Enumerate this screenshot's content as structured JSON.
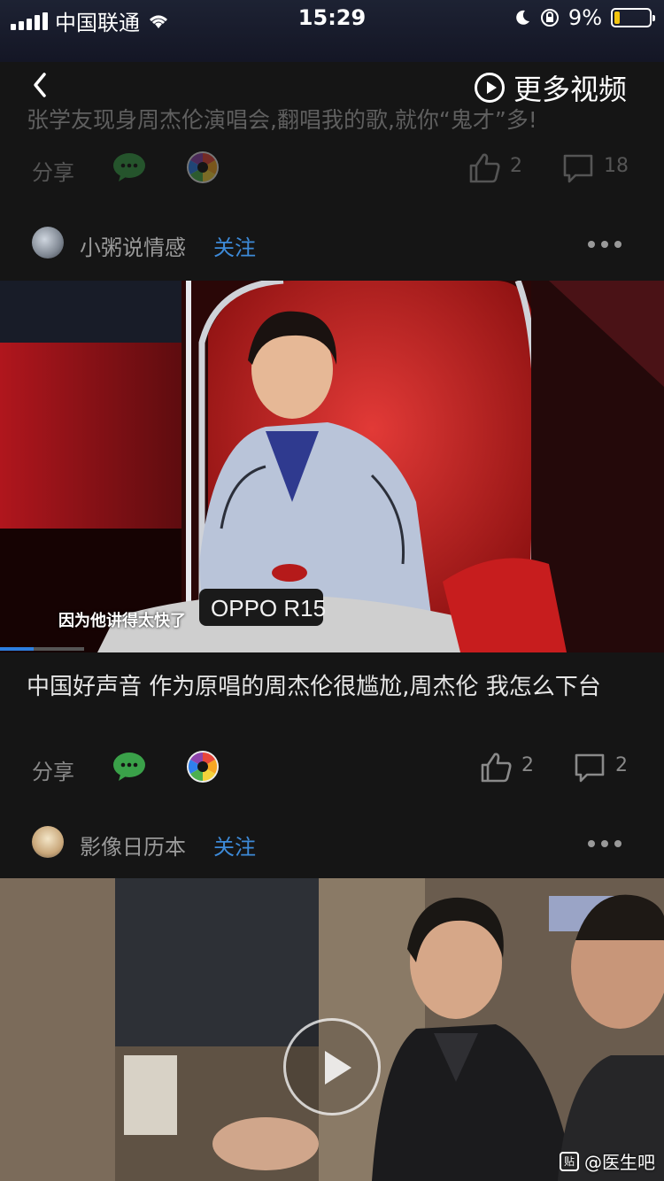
{
  "status_bar": {
    "carrier": "中国联通",
    "time": "15:29",
    "battery": "9%"
  },
  "nav": {
    "more_videos": "更多视频"
  },
  "posts": [
    {
      "title": "张学友现身周杰伦演唱会,翻唱我的歌,就你“鬼才”多!",
      "share_label": "分享",
      "likes": "2",
      "comments": "18"
    },
    {
      "author": "小粥说情感",
      "follow": "关注",
      "video_subtitle": "因为他讲得太快了",
      "video_brand": "OPPO R15",
      "progress": 0.05,
      "title": "中国好声音 作为原唱的周杰伦很尴尬,周杰伦 我怎么下台",
      "share_label": "分享",
      "likes": "2",
      "comments": "2"
    },
    {
      "author": "影像日历本",
      "follow": "关注",
      "watermark": "@医生吧",
      "watermark_badge": "贴"
    }
  ],
  "colors": {
    "background": "#151515",
    "follow": "#3d8ad8",
    "wechat": "#3aa149",
    "progress": "#2d7fe0"
  }
}
